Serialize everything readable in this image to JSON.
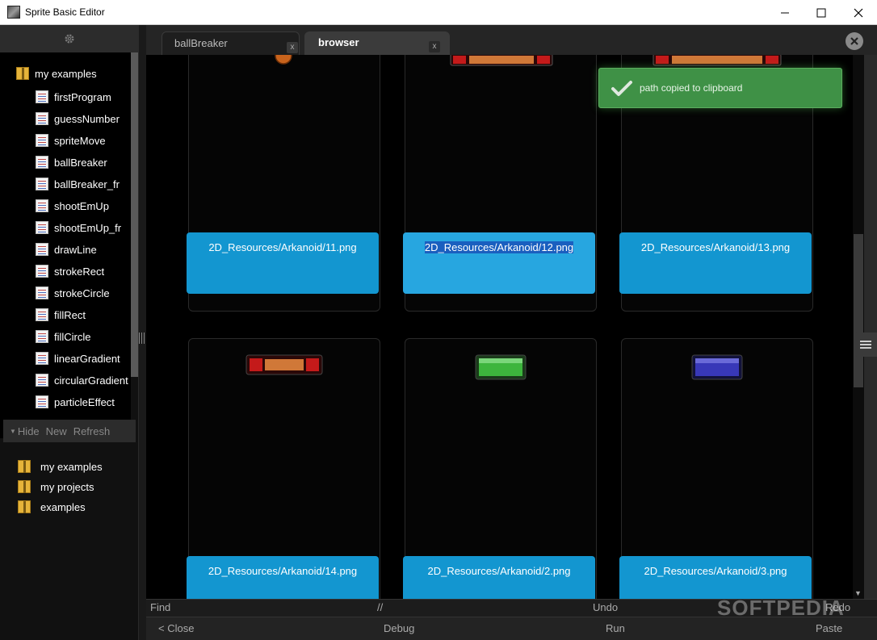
{
  "window": {
    "title": "Sprite Basic Editor"
  },
  "sidebar": {
    "root_label": "my examples",
    "items": [
      "firstProgram",
      "guessNumber",
      "spriteMove",
      "ballBreaker",
      "ballBreaker_fr",
      "shootEmUp",
      "shootEmUp_fr",
      "drawLine",
      "strokeRect",
      "strokeCircle",
      "fillRect",
      "fillCircle",
      "linearGradient",
      "circularGradient",
      "particleEffect"
    ],
    "actions": {
      "hide": "Hide",
      "new": "New",
      "refresh": "Refresh"
    },
    "projects": [
      "my examples",
      "my projects",
      "examples"
    ]
  },
  "tabs": [
    {
      "label": "ballBreaker",
      "close": "x"
    },
    {
      "label": "browser",
      "close": "x"
    }
  ],
  "toast": {
    "message": "path copied to clipboard"
  },
  "cards": [
    {
      "label": "2D_Resources/Arkanoid/11.png"
    },
    {
      "label": "2D_Resources/Arkanoid/12.png"
    },
    {
      "label": "2D_Resources/Arkanoid/13.png"
    },
    {
      "label": "2D_Resources/Arkanoid/14.png"
    },
    {
      "label": "2D_Resources/Arkanoid/2.png"
    },
    {
      "label": "2D_Resources/Arkanoid/3.png"
    }
  ],
  "toolbar": {
    "find": "Find",
    "comment": "//",
    "undo": "Undo",
    "redo": "Redo",
    "close": "< Close",
    "debug": "Debug",
    "run": "Run",
    "paste": "Paste"
  },
  "watermark": "SOFTPEDIA",
  "colors": {
    "card_label": "#1396d0",
    "toast": "#3f9146"
  }
}
